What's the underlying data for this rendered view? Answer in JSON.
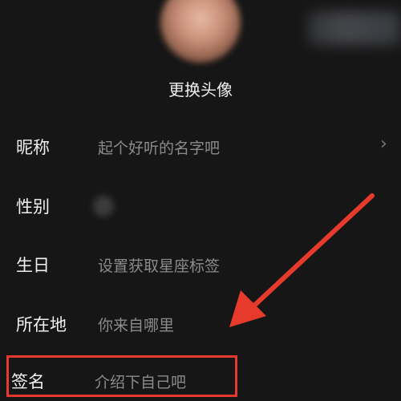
{
  "header": {
    "change_avatar_label": "更换头像"
  },
  "form": {
    "nickname": {
      "label": "昵称",
      "placeholder": "起个好听的名字吧",
      "chevron": "›"
    },
    "gender": {
      "label": "性别"
    },
    "birthday": {
      "label": "生日",
      "placeholder": "设置获取星座标签"
    },
    "location": {
      "label": "所在地",
      "placeholder": "你来自哪里"
    },
    "signature": {
      "label": "签名",
      "placeholder": "介绍下自己吧"
    }
  },
  "annotation": {
    "color": "#e53a2c"
  }
}
